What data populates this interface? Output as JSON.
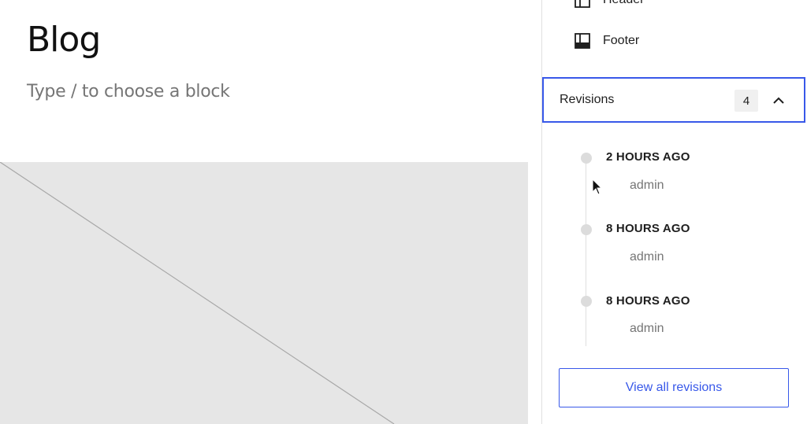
{
  "canvas": {
    "title": "Blog",
    "placeholder": "Type / to choose a block"
  },
  "sidebar": {
    "nav_items": [
      {
        "label": "Header",
        "icon": "header-icon"
      },
      {
        "label": "Footer",
        "icon": "footer-icon"
      }
    ],
    "revisions": {
      "title": "Revisions",
      "count": "4",
      "expanded": true,
      "items": [
        {
          "time": "2 HOURS AGO",
          "author": "admin"
        },
        {
          "time": "8 HOURS AGO",
          "author": "admin"
        },
        {
          "time": "8 HOURS AGO",
          "author": "admin"
        }
      ],
      "view_all_label": "View all revisions"
    }
  },
  "colors": {
    "accent": "#3858e9",
    "muted_text": "#757575",
    "placeholder_bg": "#e6e6e6"
  }
}
